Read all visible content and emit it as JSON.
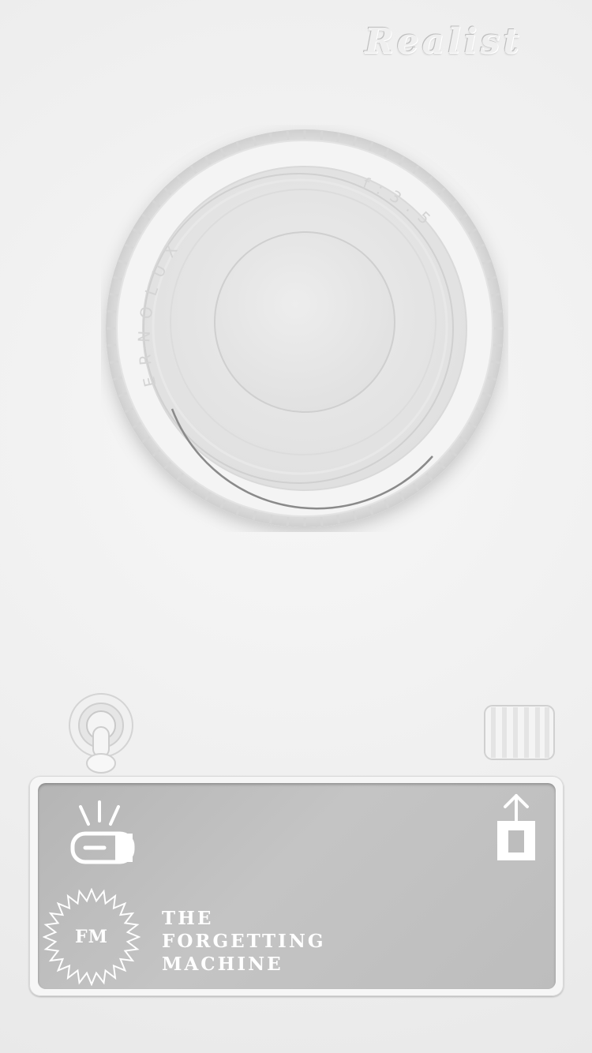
{
  "app": {
    "brand": "Realist"
  },
  "lens": {
    "engraving_left": "ERNOLUX",
    "engraving_right": "f:3.5"
  },
  "controls": {
    "flash_icon": "flash-icon",
    "share_icon": "share-upload-icon",
    "toggle_icon": "toggle-switch",
    "dial_icon": "shutter-dial"
  },
  "panel": {
    "badge": "FM",
    "title_lines": [
      "THE",
      "FORGETTING",
      "MACHINE"
    ]
  },
  "colors": {
    "background": "#f1f1f1",
    "panel": "#bdbdbd",
    "panel_text": "#ffffff"
  }
}
